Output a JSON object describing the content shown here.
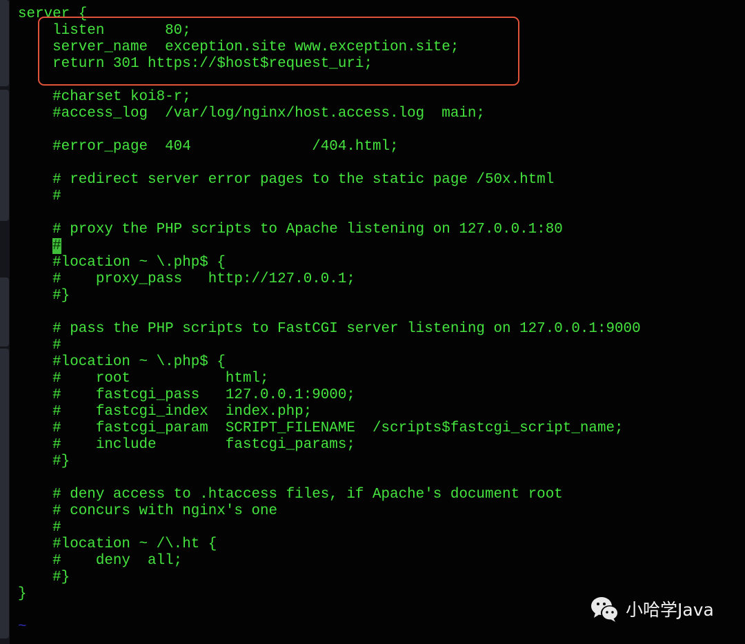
{
  "editor": {
    "lines": [
      "server {",
      "    listen       80;",
      "    server_name  exception.site www.exception.site;",
      "    return 301 https://$host$request_uri;",
      "",
      "    #charset koi8-r;",
      "    #access_log  /var/log/nginx/host.access.log  main;",
      "",
      "    #error_page  404              /404.html;",
      "",
      "    # redirect server error pages to the static page /50x.html",
      "    #",
      "",
      "    # proxy the PHP scripts to Apache listening on 127.0.0.1:80",
      "    #",
      "    #location ~ \\.php$ {",
      "    #    proxy_pass   http://127.0.0.1;",
      "    #}",
      "",
      "    # pass the PHP scripts to FastCGI server listening on 127.0.0.1:9000",
      "    #",
      "    #location ~ \\.php$ {",
      "    #    root           html;",
      "    #    fastcgi_pass   127.0.0.1:9000;",
      "    #    fastcgi_index  index.php;",
      "    #    fastcgi_param  SCRIPT_FILENAME  /scripts$fastcgi_script_name;",
      "    #    include        fastcgi_params;",
      "    #}",
      "",
      "    # deny access to .htaccess files, if Apache's document root",
      "    # concurs with nginx's one",
      "    #",
      "    #location ~ /\\.ht {",
      "    #    deny  all;",
      "    #}",
      "}",
      "",
      "~"
    ],
    "text_color": "#45e43f",
    "highlight_color": "#e0533a"
  },
  "watermark": {
    "icon": "wechat-icon",
    "text": "小哈学Java"
  }
}
